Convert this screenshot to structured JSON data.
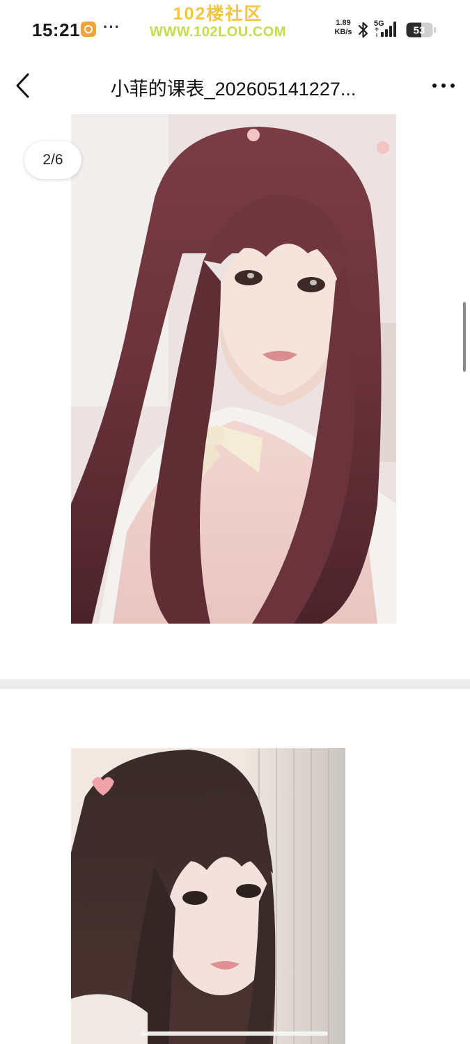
{
  "status_bar": {
    "time": "15:21",
    "more": "···",
    "watermark_line1": "102楼社区",
    "watermark_line2": "WWW.102LOU.COM",
    "net_speed_value": "1.89",
    "net_speed_unit": "KB/s",
    "network_type": "5G",
    "battery_level": "53"
  },
  "title_bar": {
    "title": "小菲的课表_202605141227..."
  },
  "viewer": {
    "page_counter": "2/6"
  },
  "icons": {
    "back": "chevron-left-icon",
    "more": "more-horizontal-icon",
    "bluetooth": "bluetooth-icon",
    "signal": "signal-icon",
    "battery": "battery-icon"
  }
}
